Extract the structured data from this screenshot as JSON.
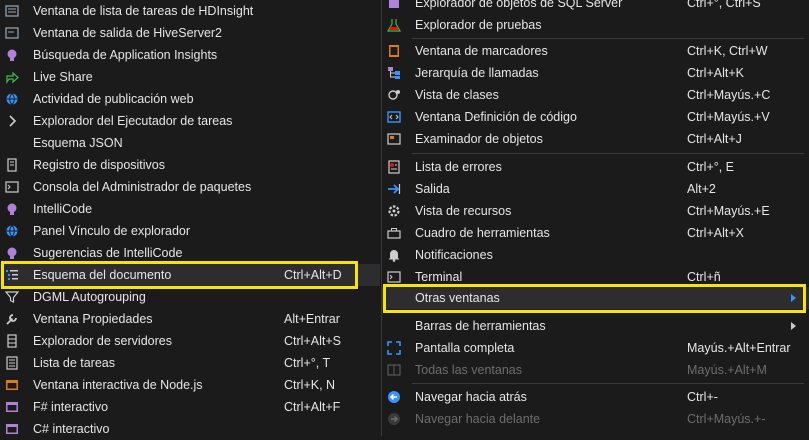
{
  "left_menu": {
    "items": [
      {
        "label": "Ventana de lista de tareas de HDInsight",
        "shortcut": "",
        "icon": "hdinsight-icon"
      },
      {
        "label": "Ventana de salida de HiveServer2",
        "shortcut": "",
        "icon": "hive-output-icon"
      },
      {
        "label": "Búsqueda de Application Insights",
        "shortcut": "",
        "icon": "lightbulb-icon"
      },
      {
        "label": "Live Share",
        "shortcut": "",
        "icon": "share-icon"
      },
      {
        "label": "Actividad de publicación web",
        "shortcut": "",
        "icon": "globe-icon"
      },
      {
        "label": "Explorador del Ejecutador de tareas",
        "shortcut": "",
        "icon": "chevron-right-icon"
      },
      {
        "label": "Esquema JSON",
        "shortcut": "",
        "icon": ""
      },
      {
        "label": "Registro de dispositivos",
        "shortcut": "",
        "icon": "device-log-icon"
      },
      {
        "label": "Consola del Administrador de paquetes",
        "shortcut": "",
        "icon": "console-icon"
      },
      {
        "label": "IntelliCode",
        "shortcut": "",
        "icon": "intellicode-icon"
      },
      {
        "label": "Panel Vínculo de explorador",
        "shortcut": "",
        "icon": "browser-link-icon"
      },
      {
        "label": "Sugerencias de IntelliCode",
        "shortcut": "",
        "icon": "intellicode-suggestions-icon"
      },
      {
        "label": "Esquema del documento",
        "shortcut": "Ctrl+Alt+D",
        "icon": "document-outline-icon"
      },
      {
        "label": "DGML Autogrouping",
        "shortcut": "",
        "icon": "filter-icon"
      },
      {
        "label": "Ventana Propiedades",
        "shortcut": "Alt+Entrar",
        "icon": "wrench-icon"
      },
      {
        "label": "Explorador de servidores",
        "shortcut": "Ctrl+Alt+S",
        "icon": "server-icon"
      },
      {
        "label": "Lista de tareas",
        "shortcut": "Ctrl+°, T",
        "icon": "task-list-icon"
      },
      {
        "label": "Ventana interactiva de Node.js",
        "shortcut": "Ctrl+K, N",
        "icon": "node-interactive-icon"
      },
      {
        "label": "F# interactivo",
        "shortcut": "Ctrl+Alt+F",
        "icon": "fsharp-icon"
      },
      {
        "label": "C# interactivo",
        "shortcut": "",
        "icon": "csharp-icon"
      }
    ]
  },
  "right_menu": {
    "items": [
      {
        "label": "Explorador de objetos de SQL Server",
        "shortcut": "Ctrl+°, Ctrl+S",
        "icon": "sql-object-explorer-icon",
        "disabled": false,
        "submenu": false
      },
      {
        "label": "Explorador de pruebas",
        "shortcut": "",
        "icon": "test-explorer-icon",
        "disabled": false,
        "submenu": false
      },
      {
        "label": "Ventana de marcadores",
        "shortcut": "Ctrl+K, Ctrl+W",
        "icon": "bookmark-icon",
        "disabled": false,
        "submenu": false
      },
      {
        "label": "Jerarquía de llamadas",
        "shortcut": "Ctrl+Alt+K",
        "icon": "call-hierarchy-icon",
        "disabled": false,
        "submenu": false
      },
      {
        "label": "Vista de clases",
        "shortcut": "Ctrl+Mayús.+C",
        "icon": "class-view-icon",
        "disabled": false,
        "submenu": false
      },
      {
        "label": "Ventana Definición de código",
        "shortcut": "Ctrl+Mayús.+V",
        "icon": "code-definition-icon",
        "disabled": false,
        "submenu": false
      },
      {
        "label": "Examinador de objetos",
        "shortcut": "Ctrl+Alt+J",
        "icon": "object-browser-icon",
        "disabled": false,
        "submenu": false
      },
      {
        "label": "Lista de errores",
        "shortcut": "Ctrl+°, E",
        "icon": "error-list-icon",
        "disabled": false,
        "submenu": false
      },
      {
        "label": "Salida",
        "shortcut": "Alt+2",
        "icon": "output-icon",
        "disabled": false,
        "submenu": false
      },
      {
        "label": "Vista de recursos",
        "shortcut": "Ctrl+Mayús.+E",
        "icon": "resource-view-icon",
        "disabled": false,
        "submenu": false
      },
      {
        "label": "Cuadro de herramientas",
        "shortcut": "Ctrl+Alt+X",
        "icon": "toolbox-icon",
        "disabled": false,
        "submenu": false
      },
      {
        "label": "Notificaciones",
        "shortcut": "",
        "icon": "bell-icon",
        "disabled": false,
        "submenu": false
      },
      {
        "label": "Terminal",
        "shortcut": "Ctrl+ñ",
        "icon": "terminal-icon",
        "disabled": false,
        "submenu": false
      },
      {
        "label": "Otras ventanas",
        "shortcut": "",
        "icon": "",
        "disabled": false,
        "submenu": true
      },
      {
        "label": "Barras de herramientas",
        "shortcut": "",
        "icon": "",
        "disabled": false,
        "submenu": true
      },
      {
        "label": "Pantalla completa",
        "shortcut": "Mayús.+Alt+Entrar",
        "icon": "full-screen-icon",
        "disabled": false,
        "submenu": false
      },
      {
        "label": "Todas las ventanas",
        "shortcut": "Mayús.+Alt+M",
        "icon": "all-windows-icon",
        "disabled": true,
        "submenu": false
      },
      {
        "label": "Navegar hacia atrás",
        "shortcut": "Ctrl+-",
        "icon": "navigate-back-icon",
        "disabled": false,
        "submenu": false
      },
      {
        "label": "Navegar hacia delante",
        "shortcut": "Ctrl+Mayús.+-",
        "icon": "navigate-forward-icon",
        "disabled": true,
        "submenu": false
      }
    ]
  },
  "colors": {
    "highlight_border": "#f5e50c",
    "menu_background": "#1b1b1c",
    "accent": "#3794ff"
  }
}
